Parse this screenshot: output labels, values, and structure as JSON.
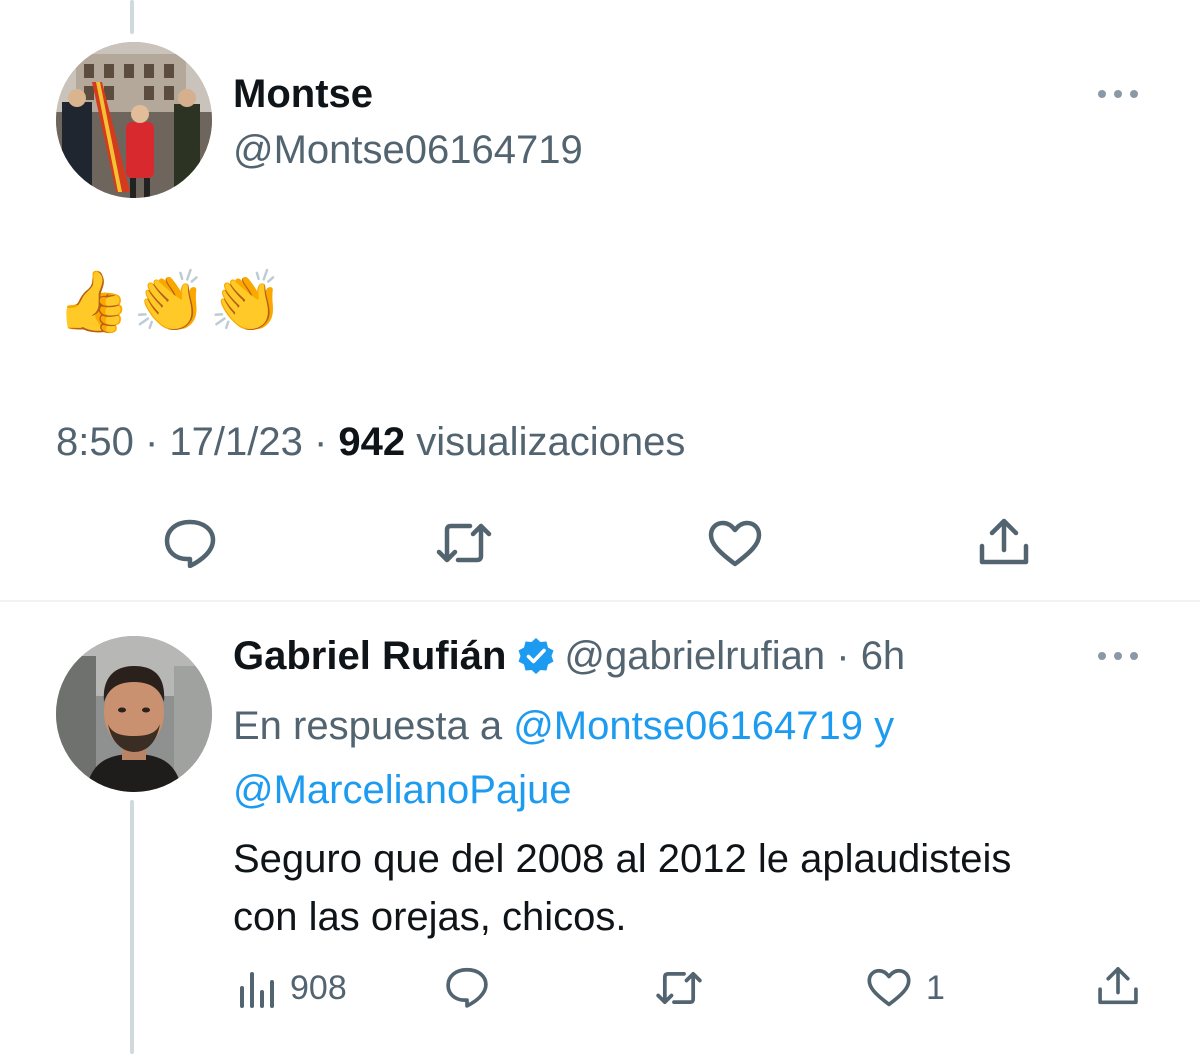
{
  "tweet": {
    "author_name": "Montse",
    "author_handle": "@Montse06164719",
    "text_emojis": "👍👏👏",
    "time": "8:50",
    "date": "17/1/23",
    "views_count": "942",
    "views_label": "visualizaciones",
    "separator": " · "
  },
  "reply": {
    "author_name": "Gabriel Rufián",
    "author_handle": "@gabrielrufian",
    "time_ago": "6h",
    "reply_prefix": "En respuesta a",
    "mention_1": "@Montse06164719",
    "conjunction": "y",
    "mention_2": "@MarcelianoPajue",
    "text_line_1": "Seguro que del 2008 al 2012 le aplaudisteis",
    "text_line_2": "con las orejas, chicos.",
    "views_count": "908",
    "likes_count": "1"
  },
  "colors": {
    "accent": "#1d9bf0",
    "secondary_text": "#536471",
    "icon": "#536471",
    "thread_line": "#cfd9de"
  },
  "icons": [
    "comment-icon",
    "retweet-icon",
    "like-icon",
    "share-icon",
    "views-icon",
    "verified-badge-icon",
    "more-icon"
  ]
}
